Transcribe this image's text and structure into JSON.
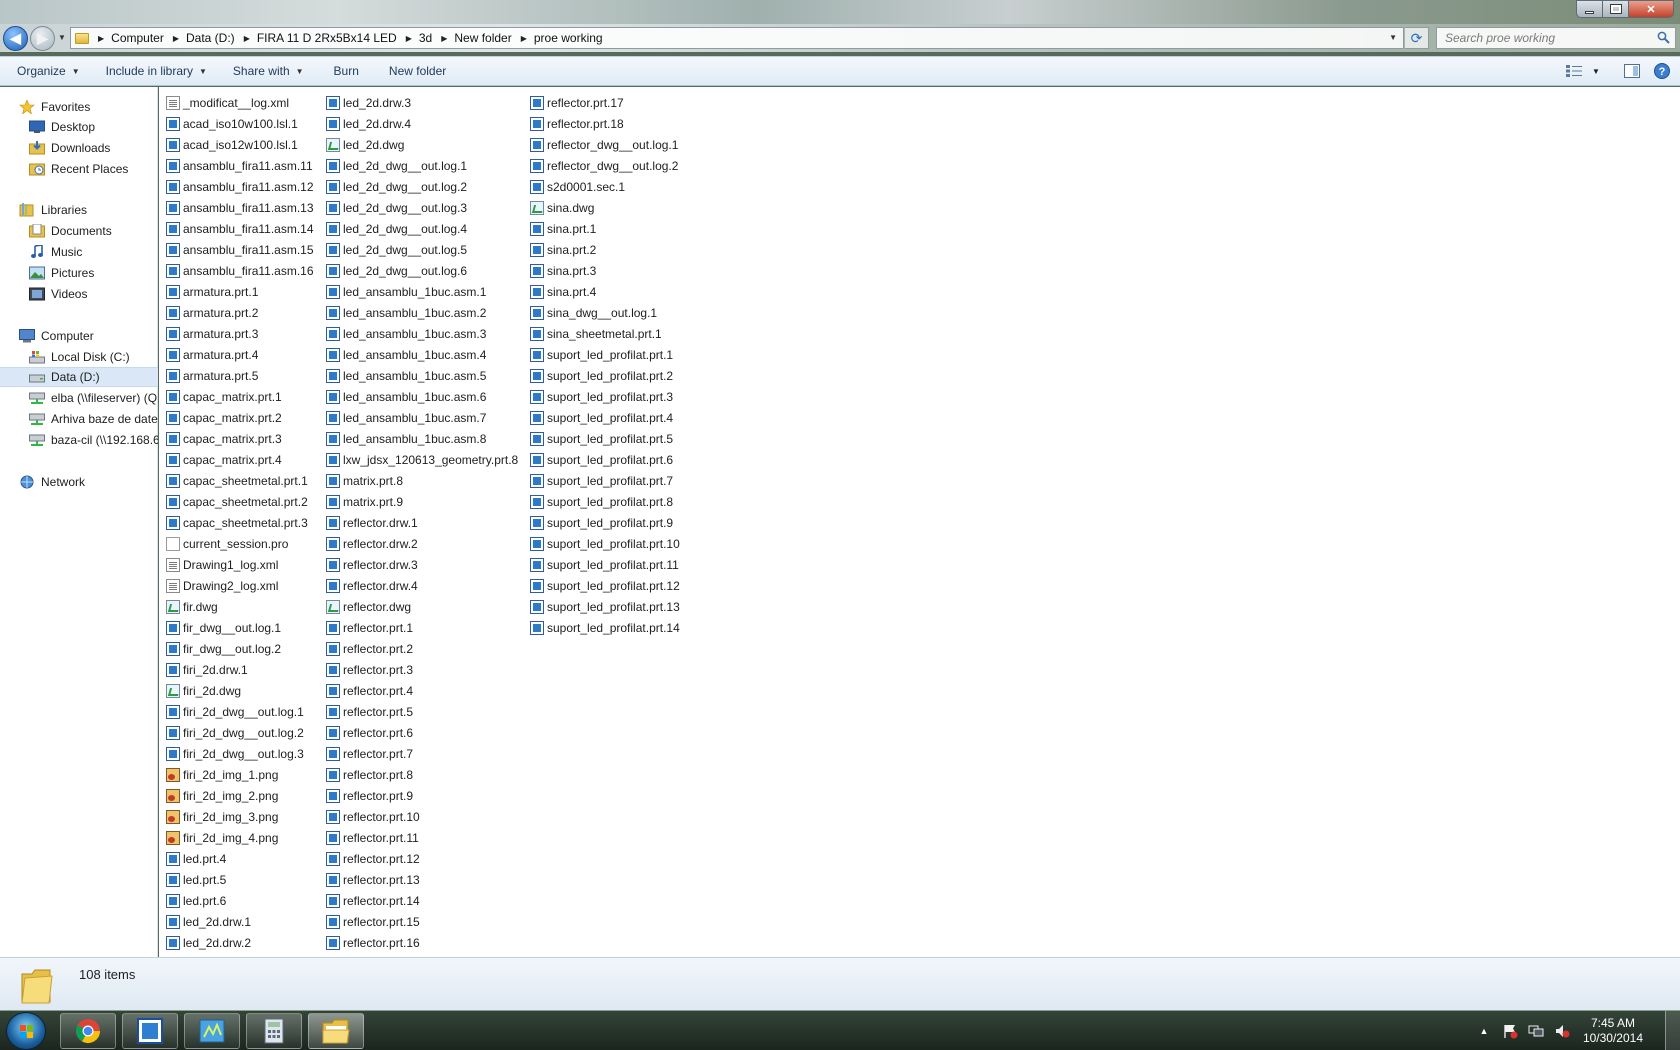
{
  "window": {
    "nav_back": "back",
    "nav_forward": "forward",
    "path": [
      "Computer",
      "Data (D:)",
      "FIRA 11 D 2Rx5Bx14 LED",
      "3d",
      "New folder",
      "proe working"
    ],
    "search_placeholder": "Search proe working"
  },
  "toolbar": {
    "organize": "Organize",
    "include_in_library": "Include in library",
    "share_with": "Share with",
    "burn": "Burn",
    "new_folder": "New folder"
  },
  "sidebar": {
    "favorites": "Favorites",
    "desktop": "Desktop",
    "downloads": "Downloads",
    "recent_places": "Recent Places",
    "libraries": "Libraries",
    "documents": "Documents",
    "music": "Music",
    "pictures": "Pictures",
    "videos": "Videos",
    "computer": "Computer",
    "local_disk": "Local Disk (C:)",
    "data_d": "Data (D:)",
    "elba": "elba (\\\\fileserver) (Q",
    "arhiva": "Arhiva baze de date",
    "baza_cil": "baza-cil (\\\\192.168.6",
    "network": "Network"
  },
  "files": {
    "col1": [
      {
        "name": "_modificat__log.xml",
        "icon": "xml"
      },
      {
        "name": "acad_iso10w100.lsl.1",
        "icon": "prt"
      },
      {
        "name": "acad_iso12w100.lsl.1",
        "icon": "prt"
      },
      {
        "name": "ansamblu_fira11.asm.11",
        "icon": "prt"
      },
      {
        "name": "ansamblu_fira11.asm.12",
        "icon": "prt"
      },
      {
        "name": "ansamblu_fira11.asm.13",
        "icon": "prt"
      },
      {
        "name": "ansamblu_fira11.asm.14",
        "icon": "prt"
      },
      {
        "name": "ansamblu_fira11.asm.15",
        "icon": "prt"
      },
      {
        "name": "ansamblu_fira11.asm.16",
        "icon": "prt"
      },
      {
        "name": "armatura.prt.1",
        "icon": "prt"
      },
      {
        "name": "armatura.prt.2",
        "icon": "prt"
      },
      {
        "name": "armatura.prt.3",
        "icon": "prt"
      },
      {
        "name": "armatura.prt.4",
        "icon": "prt"
      },
      {
        "name": "armatura.prt.5",
        "icon": "prt"
      },
      {
        "name": "capac_matrix.prt.1",
        "icon": "prt"
      },
      {
        "name": "capac_matrix.prt.2",
        "icon": "prt"
      },
      {
        "name": "capac_matrix.prt.3",
        "icon": "prt"
      },
      {
        "name": "capac_matrix.prt.4",
        "icon": "prt"
      },
      {
        "name": "capac_sheetmetal.prt.1",
        "icon": "prt"
      },
      {
        "name": "capac_sheetmetal.prt.2",
        "icon": "prt"
      },
      {
        "name": "capac_sheetmetal.prt.3",
        "icon": "prt"
      },
      {
        "name": "current_session.pro",
        "icon": "pro"
      },
      {
        "name": "Drawing1_log.xml",
        "icon": "xml"
      },
      {
        "name": "Drawing2_log.xml",
        "icon": "xml"
      },
      {
        "name": "fir.dwg",
        "icon": "dwg"
      },
      {
        "name": "fir_dwg__out.log.1",
        "icon": "prt"
      },
      {
        "name": "fir_dwg__out.log.2",
        "icon": "prt"
      },
      {
        "name": "firi_2d.drw.1",
        "icon": "prt"
      },
      {
        "name": "firi_2d.dwg",
        "icon": "dwg"
      },
      {
        "name": "firi_2d_dwg__out.log.1",
        "icon": "prt"
      },
      {
        "name": "firi_2d_dwg__out.log.2",
        "icon": "prt"
      },
      {
        "name": "firi_2d_dwg__out.log.3",
        "icon": "prt"
      },
      {
        "name": "firi_2d_img_1.png",
        "icon": "png"
      },
      {
        "name": "firi_2d_img_2.png",
        "icon": "png"
      },
      {
        "name": "firi_2d_img_3.png",
        "icon": "png"
      },
      {
        "name": "firi_2d_img_4.png",
        "icon": "png"
      },
      {
        "name": "led.prt.4",
        "icon": "prt"
      },
      {
        "name": "led.prt.5",
        "icon": "prt"
      },
      {
        "name": "led.prt.6",
        "icon": "prt"
      },
      {
        "name": "led_2d.drw.1",
        "icon": "prt"
      },
      {
        "name": "led_2d.drw.2",
        "icon": "prt"
      }
    ],
    "col2": [
      {
        "name": "led_2d.drw.3",
        "icon": "prt"
      },
      {
        "name": "led_2d.drw.4",
        "icon": "prt"
      },
      {
        "name": "led_2d.dwg",
        "icon": "dwg"
      },
      {
        "name": "led_2d_dwg__out.log.1",
        "icon": "prt"
      },
      {
        "name": "led_2d_dwg__out.log.2",
        "icon": "prt"
      },
      {
        "name": "led_2d_dwg__out.log.3",
        "icon": "prt"
      },
      {
        "name": "led_2d_dwg__out.log.4",
        "icon": "prt"
      },
      {
        "name": "led_2d_dwg__out.log.5",
        "icon": "prt"
      },
      {
        "name": "led_2d_dwg__out.log.6",
        "icon": "prt"
      },
      {
        "name": "led_ansamblu_1buc.asm.1",
        "icon": "prt"
      },
      {
        "name": "led_ansamblu_1buc.asm.2",
        "icon": "prt"
      },
      {
        "name": "led_ansamblu_1buc.asm.3",
        "icon": "prt"
      },
      {
        "name": "led_ansamblu_1buc.asm.4",
        "icon": "prt"
      },
      {
        "name": "led_ansamblu_1buc.asm.5",
        "icon": "prt"
      },
      {
        "name": "led_ansamblu_1buc.asm.6",
        "icon": "prt"
      },
      {
        "name": "led_ansamblu_1buc.asm.7",
        "icon": "prt"
      },
      {
        "name": "led_ansamblu_1buc.asm.8",
        "icon": "prt"
      },
      {
        "name": "lxw_jdsx_120613_geometry.prt.8",
        "icon": "prt"
      },
      {
        "name": "matrix.prt.8",
        "icon": "prt"
      },
      {
        "name": "matrix.prt.9",
        "icon": "prt"
      },
      {
        "name": "reflector.drw.1",
        "icon": "prt"
      },
      {
        "name": "reflector.drw.2",
        "icon": "prt"
      },
      {
        "name": "reflector.drw.3",
        "icon": "prt"
      },
      {
        "name": "reflector.drw.4",
        "icon": "prt"
      },
      {
        "name": "reflector.dwg",
        "icon": "dwg"
      },
      {
        "name": "reflector.prt.1",
        "icon": "prt"
      },
      {
        "name": "reflector.prt.2",
        "icon": "prt"
      },
      {
        "name": "reflector.prt.3",
        "icon": "prt"
      },
      {
        "name": "reflector.prt.4",
        "icon": "prt"
      },
      {
        "name": "reflector.prt.5",
        "icon": "prt"
      },
      {
        "name": "reflector.prt.6",
        "icon": "prt"
      },
      {
        "name": "reflector.prt.7",
        "icon": "prt"
      },
      {
        "name": "reflector.prt.8",
        "icon": "prt"
      },
      {
        "name": "reflector.prt.9",
        "icon": "prt"
      },
      {
        "name": "reflector.prt.10",
        "icon": "prt"
      },
      {
        "name": "reflector.prt.11",
        "icon": "prt"
      },
      {
        "name": "reflector.prt.12",
        "icon": "prt"
      },
      {
        "name": "reflector.prt.13",
        "icon": "prt"
      },
      {
        "name": "reflector.prt.14",
        "icon": "prt"
      },
      {
        "name": "reflector.prt.15",
        "icon": "prt"
      },
      {
        "name": "reflector.prt.16",
        "icon": "prt"
      }
    ],
    "col3": [
      {
        "name": "reflector.prt.17",
        "icon": "prt"
      },
      {
        "name": "reflector.prt.18",
        "icon": "prt"
      },
      {
        "name": "reflector_dwg__out.log.1",
        "icon": "prt"
      },
      {
        "name": "reflector_dwg__out.log.2",
        "icon": "prt"
      },
      {
        "name": "s2d0001.sec.1",
        "icon": "prt"
      },
      {
        "name": "sina.dwg",
        "icon": "dwg"
      },
      {
        "name": "sina.prt.1",
        "icon": "prt"
      },
      {
        "name": "sina.prt.2",
        "icon": "prt"
      },
      {
        "name": "sina.prt.3",
        "icon": "prt"
      },
      {
        "name": "sina.prt.4",
        "icon": "prt"
      },
      {
        "name": "sina_dwg__out.log.1",
        "icon": "prt"
      },
      {
        "name": "sina_sheetmetal.prt.1",
        "icon": "prt"
      },
      {
        "name": "suport_led_profilat.prt.1",
        "icon": "prt"
      },
      {
        "name": "suport_led_profilat.prt.2",
        "icon": "prt"
      },
      {
        "name": "suport_led_profilat.prt.3",
        "icon": "prt"
      },
      {
        "name": "suport_led_profilat.prt.4",
        "icon": "prt"
      },
      {
        "name": "suport_led_profilat.prt.5",
        "icon": "prt"
      },
      {
        "name": "suport_led_profilat.prt.6",
        "icon": "prt"
      },
      {
        "name": "suport_led_profilat.prt.7",
        "icon": "prt"
      },
      {
        "name": "suport_led_profilat.prt.8",
        "icon": "prt"
      },
      {
        "name": "suport_led_profilat.prt.9",
        "icon": "prt"
      },
      {
        "name": "suport_led_profilat.prt.10",
        "icon": "prt"
      },
      {
        "name": "suport_led_profilat.prt.11",
        "icon": "prt"
      },
      {
        "name": "suport_led_profilat.prt.12",
        "icon": "prt"
      },
      {
        "name": "suport_led_profilat.prt.13",
        "icon": "prt"
      },
      {
        "name": "suport_led_profilat.prt.14",
        "icon": "prt"
      }
    ]
  },
  "status": {
    "count": "108 items"
  },
  "taskbar": {
    "time": "7:45 AM",
    "date": "10/30/2014",
    "apps": [
      "chrome-icon",
      "creo-icon",
      "sketch-app-icon",
      "calculator-icon",
      "explorer-icon"
    ]
  }
}
